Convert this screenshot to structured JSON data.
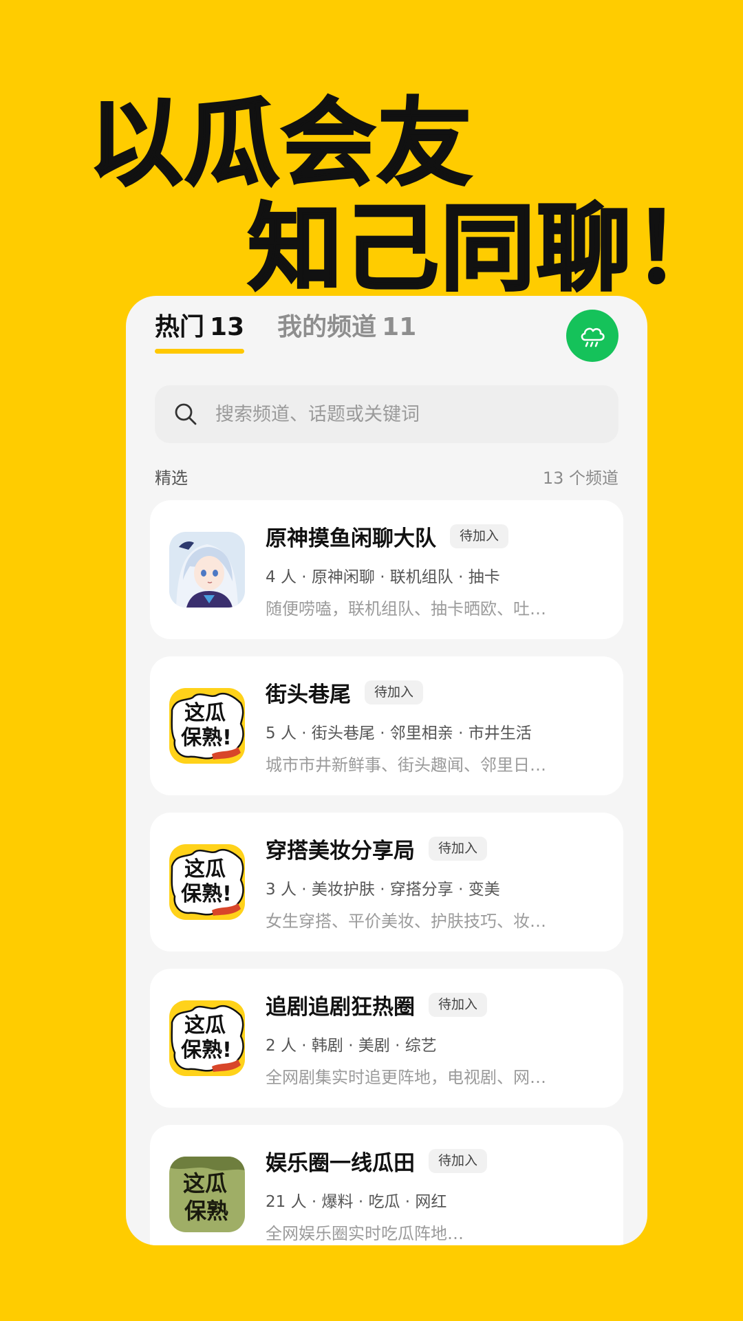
{
  "headline": {
    "line1": "以瓜会友",
    "line2": "知己同聊！"
  },
  "tabs": [
    {
      "label": "热门",
      "count": "13",
      "active": true
    },
    {
      "label": "我的频道",
      "count": "11",
      "active": false
    }
  ],
  "cloud_button_icon": "cloud-rain-icon",
  "search": {
    "placeholder": "搜索频道、话题或关键词",
    "value": ""
  },
  "section": {
    "label": "精选",
    "count": "13 个频道"
  },
  "channels": [
    {
      "title": "原神摸鱼闲聊大队",
      "badge": "待加入",
      "meta": "4 人 · 原神闲聊 · 联机组队 · 抽卡",
      "desc": "随便唠嗑，联机组队、抽卡晒欧、吐…",
      "avatar": {
        "type": "anime",
        "text_top": "",
        "text_bottom": ""
      }
    },
    {
      "title": "街头巷尾",
      "badge": "待加入",
      "meta": "5 人 · 街头巷尾 · 邻里相亲 · 市井生活",
      "desc": "城市市井新鲜事、街头趣闻、邻里日…",
      "avatar": {
        "type": "melon",
        "text_top": "这瓜",
        "text_bottom": "保熟!"
      }
    },
    {
      "title": "穿搭美妆分享局",
      "badge": "待加入",
      "meta": "3 人 · 美妆护肤 · 穿搭分享 · 变美",
      "desc": "女生穿搭、平价美妆、护肤技巧、妆…",
      "avatar": {
        "type": "melon",
        "text_top": "这瓜",
        "text_bottom": "保熟!"
      }
    },
    {
      "title": "追剧追剧狂热圈",
      "badge": "待加入",
      "meta": "2 人 · 韩剧 · 美剧 · 综艺",
      "desc": "全网剧集实时追更阵地，电视剧、网…",
      "avatar": {
        "type": "melon",
        "text_top": "这瓜",
        "text_bottom": "保熟!"
      }
    },
    {
      "title": "娱乐圈一线瓜田",
      "badge": "待加入",
      "meta": "21 人 · 爆料 · 吃瓜 · 网红",
      "desc": "全网娱乐圈实时吃瓜阵地…",
      "avatar": {
        "type": "melon-green",
        "text_top": "这瓜",
        "text_bottom": "保熟"
      }
    }
  ],
  "colors": {
    "background": "#FFCC00",
    "accent": "#FFC800",
    "green": "#15C25A"
  }
}
